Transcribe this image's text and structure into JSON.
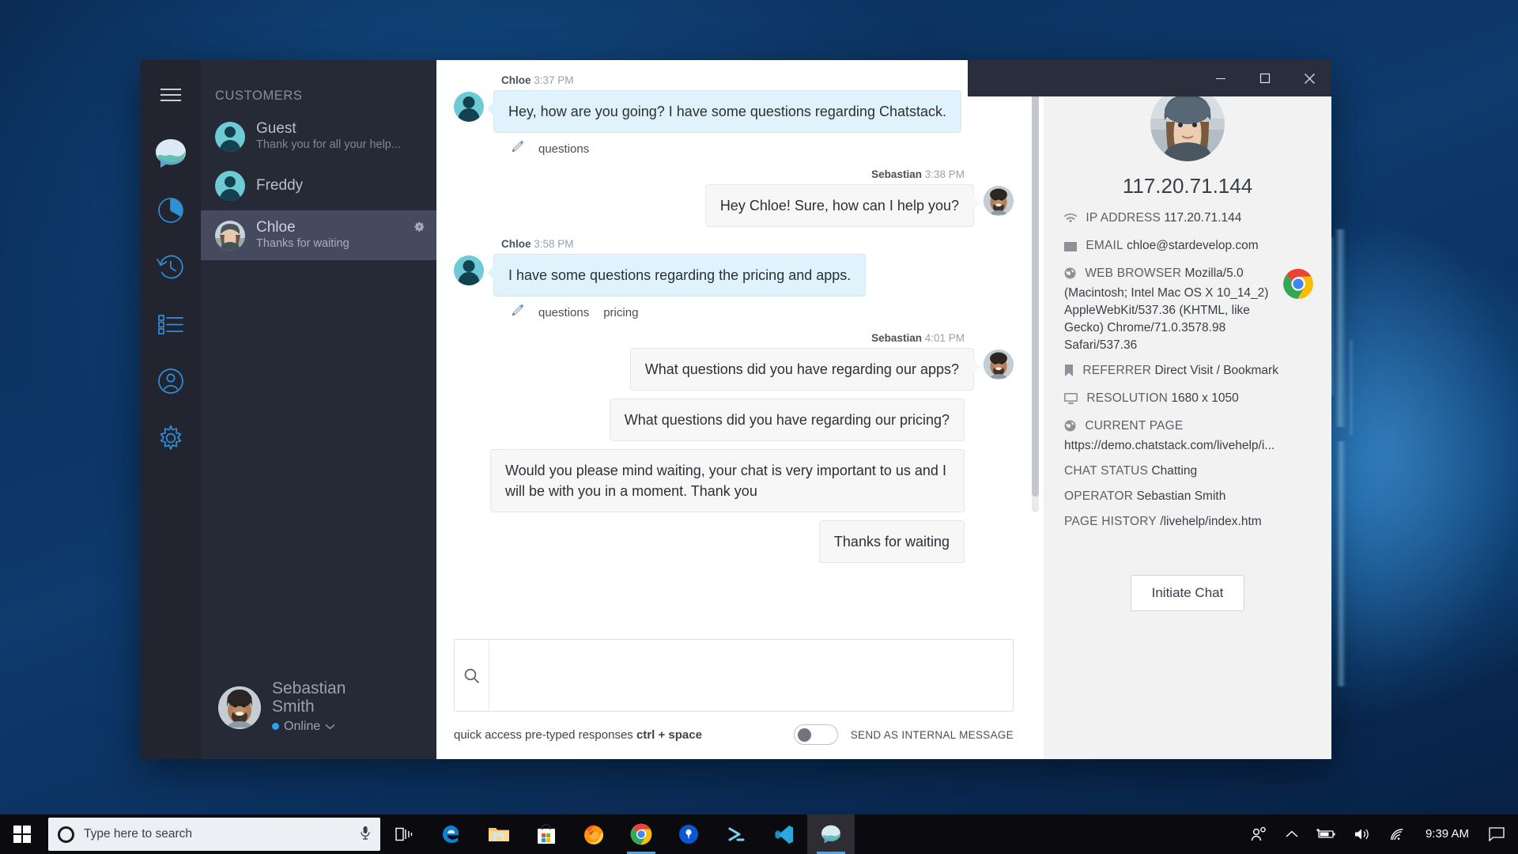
{
  "desktop": {
    "taskbar": {
      "search_placeholder": "Type here to search",
      "clock": "9:39 AM",
      "start_icon": "windows-start-icon",
      "cortana_icon": "cortana-circle-icon",
      "mic_icon": "microphone-icon",
      "apps": [
        {
          "name": "task-view-icon",
          "label": "Task View"
        },
        {
          "name": "edge-icon",
          "label": "Microsoft Edge"
        },
        {
          "name": "file-explorer-icon",
          "label": "File Explorer"
        },
        {
          "name": "microsoft-store-icon",
          "label": "Microsoft Store"
        },
        {
          "name": "firefox-icon",
          "label": "Firefox"
        },
        {
          "name": "chrome-icon",
          "label": "Google Chrome"
        },
        {
          "name": "pia-vpn-icon",
          "label": "Private Internet Access"
        },
        {
          "name": "powershell-icon",
          "label": "Windows PowerShell"
        },
        {
          "name": "vscode-icon",
          "label": "Visual Studio Code"
        },
        {
          "name": "chatstack-icon",
          "label": "Chatstack"
        }
      ],
      "tray": [
        {
          "name": "people-icon"
        },
        {
          "name": "show-hidden-icons-chevron"
        },
        {
          "name": "battery-charging-icon"
        },
        {
          "name": "volume-icon"
        },
        {
          "name": "wifi-icon"
        },
        {
          "name": "action-center-icon"
        }
      ]
    }
  },
  "window": {
    "controls": {
      "minimize": "minimize-button",
      "maximize": "maximize-button",
      "close": "close-button"
    }
  },
  "rail": {
    "menu_icon": "hamburger-menu-icon",
    "items": [
      {
        "name": "chatstack-logo-icon",
        "label": "Chatstack"
      },
      {
        "name": "pie-chart-icon",
        "label": "Reports"
      },
      {
        "name": "history-clock-icon",
        "label": "Chat History"
      },
      {
        "name": "list-icon",
        "label": "Canned Responses"
      },
      {
        "name": "user-circle-icon",
        "label": "Operators"
      },
      {
        "name": "gear-icon",
        "label": "Settings"
      }
    ]
  },
  "customers": {
    "heading": "CUSTOMERS",
    "list": [
      {
        "name": "Guest",
        "preview": "Thank you for all your help...",
        "avatar": "silhouette",
        "active": false,
        "gear": false
      },
      {
        "name": "Freddy",
        "preview": "",
        "avatar": "silhouette",
        "active": false,
        "gear": false
      },
      {
        "name": "Chloe",
        "preview": "Thanks for waiting",
        "avatar": "photo-chloe",
        "active": true,
        "gear": true
      }
    ]
  },
  "operator": {
    "name": "Sebastian Smith",
    "status": "Online",
    "status_color": "#29a3ea",
    "chevron": "chevron-down-icon",
    "avatar": "photo-sebastian"
  },
  "chat": {
    "messages": [
      {
        "sender": "Chloe",
        "time": "3:37 PM",
        "side": "in",
        "avatar": "silhouette",
        "show_meta": true,
        "bubbles": [
          "Hey, how are you going? I have some questions regarding Chatstack."
        ],
        "tags": [
          "questions"
        ]
      },
      {
        "sender": "Sebastian",
        "time": "3:38 PM",
        "side": "out",
        "avatar": "photo-sebastian",
        "show_meta": true,
        "bubbles": [
          "Hey Chloe! Sure, how can I help you?"
        ],
        "tags": []
      },
      {
        "sender": "Chloe",
        "time": "3:58 PM",
        "side": "in",
        "avatar": "silhouette",
        "show_meta": true,
        "bubbles": [
          "I have some questions regarding the pricing and apps."
        ],
        "tags": [
          "questions",
          "pricing"
        ]
      },
      {
        "sender": "Sebastian",
        "time": "4:01 PM",
        "side": "out",
        "avatar": "photo-sebastian",
        "show_meta": true,
        "bubbles": [
          "What questions did you have regarding our apps?",
          "What questions did you have regarding our pricing?",
          "Would you please mind waiting, your chat is very important to us and I will be with you in a moment. Thank you",
          "Thanks for waiting"
        ],
        "tags": []
      }
    ],
    "tag_icon": "pencil-tag-icon"
  },
  "composer": {
    "search_icon": "search-icon",
    "value": "",
    "placeholder": "",
    "hint_prefix": "quick access pre-typed responses ",
    "hint_shortcut": "ctrl + space",
    "internal_label": "SEND AS INTERNAL MESSAGE",
    "internal_on": false
  },
  "info": {
    "avatar": "photo-chloe",
    "ip_heading": "117.20.71.144",
    "rows": [
      {
        "icon": "wifi-icon",
        "label": "IP ADDRESS",
        "value": "117.20.71.144"
      },
      {
        "icon": "envelope-icon",
        "label": "EMAIL",
        "value": "chloe@stardevelop.com"
      },
      {
        "icon": "globe-icon",
        "label": "WEB BROWSER",
        "value": "Mozilla/5.0 (Macintosh; Intel Mac OS X 10_14_2) AppleWebKit/537.36 (KHTML, like Gecko) Chrome/71.0.3578.98 Safari/537.36"
      },
      {
        "icon": "bookmark-icon",
        "label": "REFERRER",
        "value": "Direct Visit / Bookmark"
      },
      {
        "icon": "monitor-icon",
        "label": "RESOLUTION",
        "value": "1680 x 1050"
      },
      {
        "icon": "globe-icon",
        "label": "CURRENT PAGE",
        "value": "https://demo.chatstack.com/livehelp/i..."
      },
      {
        "icon": "none",
        "label": "CHAT STATUS",
        "value": "Chatting"
      },
      {
        "icon": "none",
        "label": "OPERATOR",
        "value": "Sebastian Smith"
      },
      {
        "icon": "none",
        "label": "PAGE HISTORY",
        "value": "/livehelp/index.htm"
      }
    ],
    "browser_badge": "chrome-icon",
    "initiate_button": "Initiate Chat"
  }
}
